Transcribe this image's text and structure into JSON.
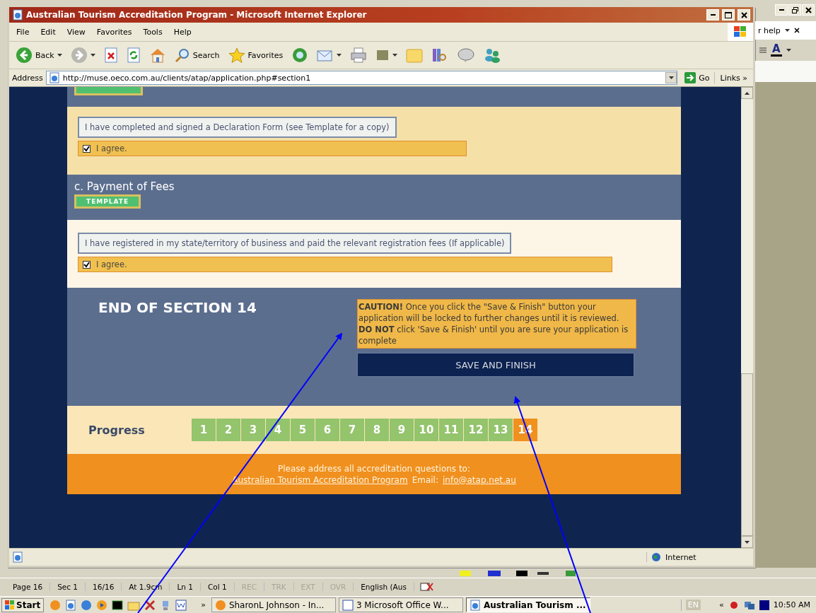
{
  "ie_window": {
    "title": "Australian Tourism Accreditation Program - Microsoft Internet Explorer",
    "menu": [
      "File",
      "Edit",
      "View",
      "Favorites",
      "Tools",
      "Help"
    ],
    "toolbar": [
      {
        "kind": "back",
        "label": "Back",
        "dropdown": true
      },
      {
        "kind": "forward",
        "dropdown": true
      },
      {
        "kind": "stop",
        "dropdown": false
      },
      {
        "kind": "refresh",
        "dropdown": false
      },
      {
        "kind": "home",
        "dropdown": false
      },
      {
        "kind": "search",
        "label": "Search",
        "dropdown": false
      },
      {
        "kind": "favorites",
        "label": "Favorites",
        "dropdown": false
      },
      {
        "kind": "media",
        "dropdown": false
      },
      {
        "kind": "mail",
        "dropdown": true
      },
      {
        "kind": "print",
        "dropdown": false
      },
      {
        "kind": "edit",
        "dropdown": true
      },
      {
        "kind": "folder",
        "dropdown": false
      },
      {
        "kind": "research",
        "dropdown": false
      },
      {
        "kind": "messenger",
        "dropdown": false
      },
      {
        "kind": "contacts",
        "dropdown": false
      }
    ],
    "address": {
      "label": "Address",
      "value": "http://muse.oeco.com.au/clients/atap/application.php#section1",
      "go": "Go",
      "links": "Links",
      "links_chevron": "»"
    },
    "page": {
      "top_template": {
        "visible": true
      },
      "declaration": {
        "statement": "I have completed and signed a Declaration Form (see Template for a copy)",
        "agree": {
          "label": "I agree.",
          "checked": true
        }
      },
      "payment": {
        "heading": "c. Payment of Fees",
        "template": "TEMPLATE",
        "statement": "I have registered in my state/territory of business and paid the relevant registration fees (If applicable)",
        "agree": {
          "label": "I agree.",
          "checked": true
        }
      },
      "end": {
        "heading": "END OF SECTION 14",
        "caution": [
          "**CAUTION!** Once you click the \"Save & Finish\" button your application will be locked to further changes until it is reviewed.",
          "**DO NOT** click 'Save & Finish' until you are sure your application is complete"
        ],
        "button": "SAVE AND FINISH"
      },
      "progress": {
        "label": "Progress",
        "steps": [
          {
            "label": "1",
            "selected": false
          },
          {
            "label": "2",
            "selected": false
          },
          {
            "label": "3",
            "selected": false
          },
          {
            "label": "4",
            "selected": false
          },
          {
            "label": "5",
            "selected": false
          },
          {
            "label": "6",
            "selected": false
          },
          {
            "label": "7",
            "selected": false
          },
          {
            "label": "8",
            "selected": false
          },
          {
            "label": "9",
            "selected": false
          },
          {
            "label": "10",
            "selected": false
          },
          {
            "label": "11",
            "selected": false
          },
          {
            "label": "12",
            "selected": false
          },
          {
            "label": "13",
            "selected": false
          },
          {
            "label": "14",
            "selected": true
          }
        ]
      },
      "footer": {
        "line": "Please address all accreditation questions to:",
        "program_link": "Australian Tourism Accreditation Program",
        "email_label": "Email:",
        "email_link": "info@atap.net.au"
      }
    },
    "status_bar": {
      "zone": "Internet"
    }
  },
  "word_window": {
    "help_field": "r help",
    "font_color": "A",
    "status_bar": [
      {
        "text": "Page 16",
        "disabled": false
      },
      {
        "text": "Sec 1",
        "disabled": false
      },
      {
        "text": "16/16",
        "disabled": false
      },
      {
        "text": "At 1.9cm",
        "disabled": false
      },
      {
        "text": "Ln 1",
        "disabled": false
      },
      {
        "text": "Col 1",
        "disabled": false
      },
      {
        "text": "REC",
        "disabled": true
      },
      {
        "text": "TRK",
        "disabled": true
      },
      {
        "text": "EXT",
        "disabled": true
      },
      {
        "text": "OVR",
        "disabled": true
      },
      {
        "text": "English (Aus",
        "disabled": false
      }
    ]
  },
  "taskbar": {
    "start": "Start",
    "chevron": "»",
    "tasks": [
      {
        "label": "SharonL Johnson - In...",
        "kind": "messenger",
        "selected": false
      },
      {
        "label": "3 Microsoft Office W...",
        "kind": "word",
        "selected": false
      },
      {
        "label": "Australian Tourism ...",
        "kind": "ie",
        "selected": true
      }
    ],
    "tray": {
      "language": "EN",
      "chevron": "«",
      "clock": "10:50 AM"
    }
  }
}
